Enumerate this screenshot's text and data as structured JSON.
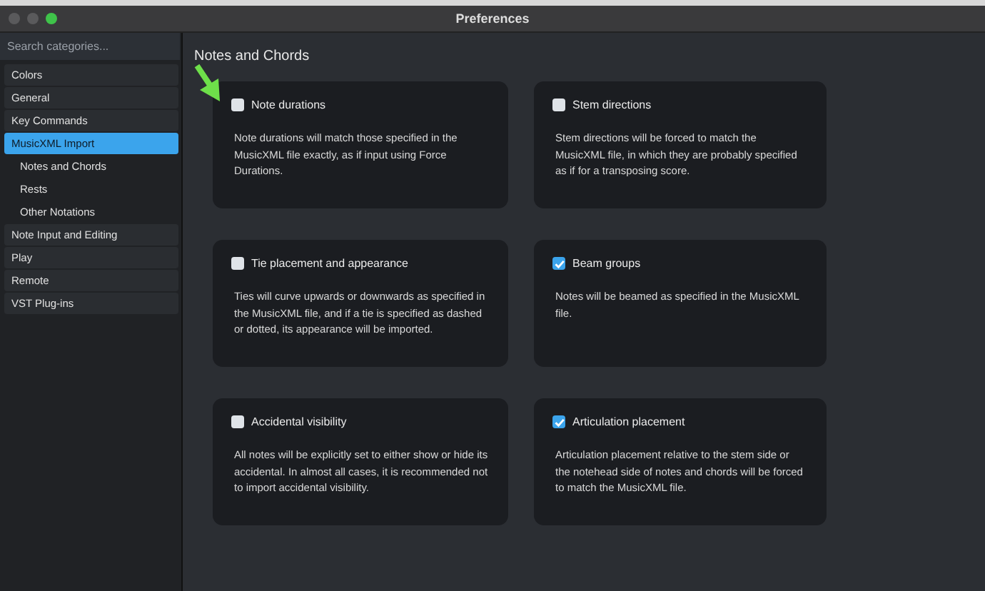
{
  "window": {
    "title": "Preferences"
  },
  "sidebar": {
    "search": {
      "placeholder": "Search categories..."
    },
    "items": [
      {
        "label": "Colors",
        "selected": false
      },
      {
        "label": "General",
        "selected": false
      },
      {
        "label": "Key Commands",
        "selected": false
      },
      {
        "label": "MusicXML Import",
        "selected": true,
        "children": [
          {
            "label": "Notes and Chords",
            "selected": false
          },
          {
            "label": "Rests",
            "selected": false
          },
          {
            "label": "Other Notations",
            "selected": false
          }
        ]
      },
      {
        "label": "Note Input and Editing",
        "selected": false
      },
      {
        "label": "Play",
        "selected": false
      },
      {
        "label": "Remote",
        "selected": false
      },
      {
        "label": "VST Plug-ins",
        "selected": false
      }
    ]
  },
  "page": {
    "title": "Notes and Chords",
    "options": [
      {
        "label": "Note durations",
        "checked": false,
        "description": "Note durations will match those specified in the MusicXML file exactly, as if input using Force Durations."
      },
      {
        "label": "Stem directions",
        "checked": false,
        "description": "Stem directions will be forced to match the MusicXML file, in which they are probably specified as if for a transposing score."
      },
      {
        "label": "Tie placement and appearance",
        "checked": false,
        "description": "Ties will curve upwards or downwards as specified in the MusicXML file, and if a tie is specified as dashed or dotted, its appearance will be imported."
      },
      {
        "label": "Beam groups",
        "checked": true,
        "description": "Notes will be beamed as specified in the MusicXML file."
      },
      {
        "label": "Accidental visibility",
        "checked": false,
        "description": "All notes will be explicitly set to either show or hide its accidental. In almost all cases, it is recommended not to import accidental visibility."
      },
      {
        "label": "Articulation placement",
        "checked": true,
        "description": "Articulation placement relative to the stem side or the notehead side of notes and chords will be forced to match the MusicXML file."
      }
    ]
  }
}
